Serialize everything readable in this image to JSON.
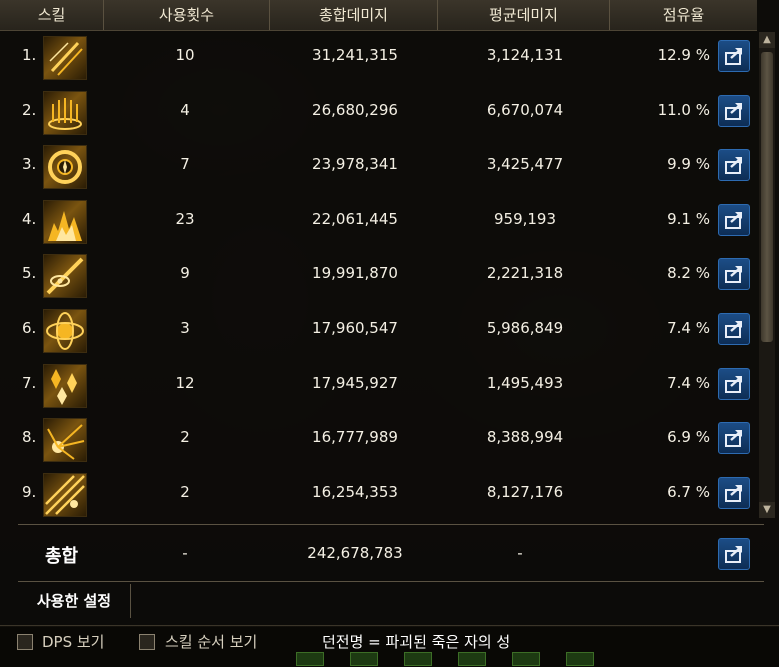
{
  "header": {
    "skill": "스킬",
    "use_count": "사용횟수",
    "total_damage": "총합데미지",
    "avg_damage": "평균데미지",
    "share": "점유율"
  },
  "rows": [
    {
      "rank": "1.",
      "count": "10",
      "total": "31,241,315",
      "avg": "3,124,131",
      "share": "12.9 %",
      "icon": "golden-slash-skill-icon"
    },
    {
      "rank": "2.",
      "count": "4",
      "total": "26,680,296",
      "avg": "6,670,074",
      "share": "11.0 %",
      "icon": "golden-pillars-skill-icon"
    },
    {
      "rank": "3.",
      "count": "7",
      "total": "23,978,341",
      "avg": "3,425,477",
      "share": "9.9 %",
      "icon": "golden-ring-skill-icon"
    },
    {
      "rank": "4.",
      "count": "23",
      "total": "22,061,445",
      "avg": "959,193",
      "share": "9.1 %",
      "icon": "golden-flame-skill-icon"
    },
    {
      "rank": "5.",
      "count": "9",
      "total": "19,991,870",
      "avg": "2,221,318",
      "share": "8.2 %",
      "icon": "golden-eye-skill-icon"
    },
    {
      "rank": "6.",
      "count": "3",
      "total": "17,960,547",
      "avg": "5,986,849",
      "share": "7.4 %",
      "icon": "golden-orb-skill-icon"
    },
    {
      "rank": "7.",
      "count": "12",
      "total": "17,945,927",
      "avg": "1,495,493",
      "share": "7.4 %",
      "icon": "golden-crystal-skill-icon"
    },
    {
      "rank": "8.",
      "count": "2",
      "total": "16,777,989",
      "avg": "8,388,994",
      "share": "6.9 %",
      "icon": "golden-burst-skill-icon"
    },
    {
      "rank": "9.",
      "count": "2",
      "total": "16,254,353",
      "avg": "8,127,176",
      "share": "6.7 %",
      "icon": "golden-rays-skill-icon"
    }
  ],
  "totals": {
    "label": "총합",
    "count": "-",
    "total": "242,678,783",
    "avg": "-"
  },
  "tab_label": "사용한 설정",
  "footer": {
    "dps_label": "DPS 보기",
    "skill_order_label": "스킬 순서 보기",
    "dungeon_text": "던전명 = 파괴된 죽은 자의 성"
  },
  "icons": {
    "share_button": "share-export-icon"
  },
  "colors": {
    "accent_gold": "#d9a020",
    "button_blue": "#1c4d86"
  }
}
